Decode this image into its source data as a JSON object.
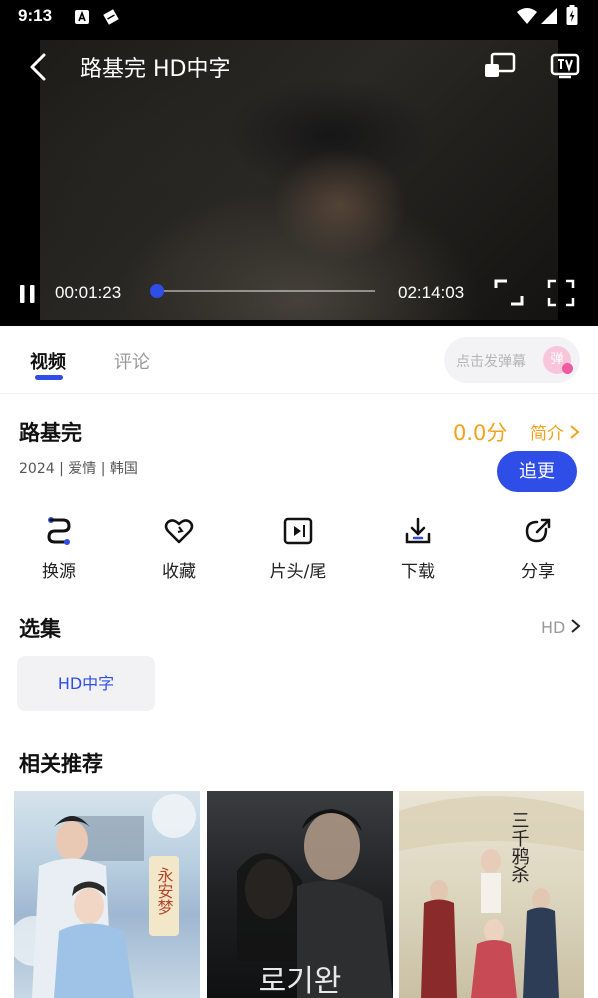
{
  "status_bar": {
    "time": "9:13",
    "icons": [
      "a-notification-icon",
      "diamond-notification-icon",
      "wifi-icon",
      "signal-icon",
      "battery-icon"
    ]
  },
  "player": {
    "title": "路基完  HD中字",
    "current_time": "00:01:23",
    "total_time": "02:14:03",
    "progress": 0.0103,
    "accent_color": "#2f4ee8",
    "icons": [
      "back-icon",
      "screen-mirror-icon",
      "tv-cast-icon",
      "pause-icon",
      "rotate-icon",
      "fullscreen-icon"
    ]
  },
  "tabs": {
    "items": [
      {
        "label": "视频",
        "active": true
      },
      {
        "label": "评论",
        "active": false
      }
    ],
    "danmaku_placeholder": "点击发弹幕",
    "danmaku_icon_text": "弹"
  },
  "info": {
    "title": "路基完",
    "meta": "2024 | 爱情 | 韩国",
    "score": "0.0分",
    "intro_label": "简介",
    "follow_label": "追更",
    "accent_orange": "#f5a11c"
  },
  "actions": [
    {
      "label": "换源",
      "icon": "switch-source-icon"
    },
    {
      "label": "收藏",
      "icon": "heart-icon"
    },
    {
      "label": "片头/尾",
      "icon": "skip-intro-icon"
    },
    {
      "label": "下载",
      "icon": "download-icon"
    },
    {
      "label": "分享",
      "icon": "share-icon"
    }
  ],
  "episodes": {
    "title": "选集",
    "quality": "HD",
    "items": [
      "HD中字"
    ]
  },
  "recommendations": {
    "title": "相关推荐",
    "posters": [
      {
        "text": "永安梦"
      },
      {
        "text": "로기완"
      },
      {
        "text": "三千鸦杀"
      }
    ]
  }
}
